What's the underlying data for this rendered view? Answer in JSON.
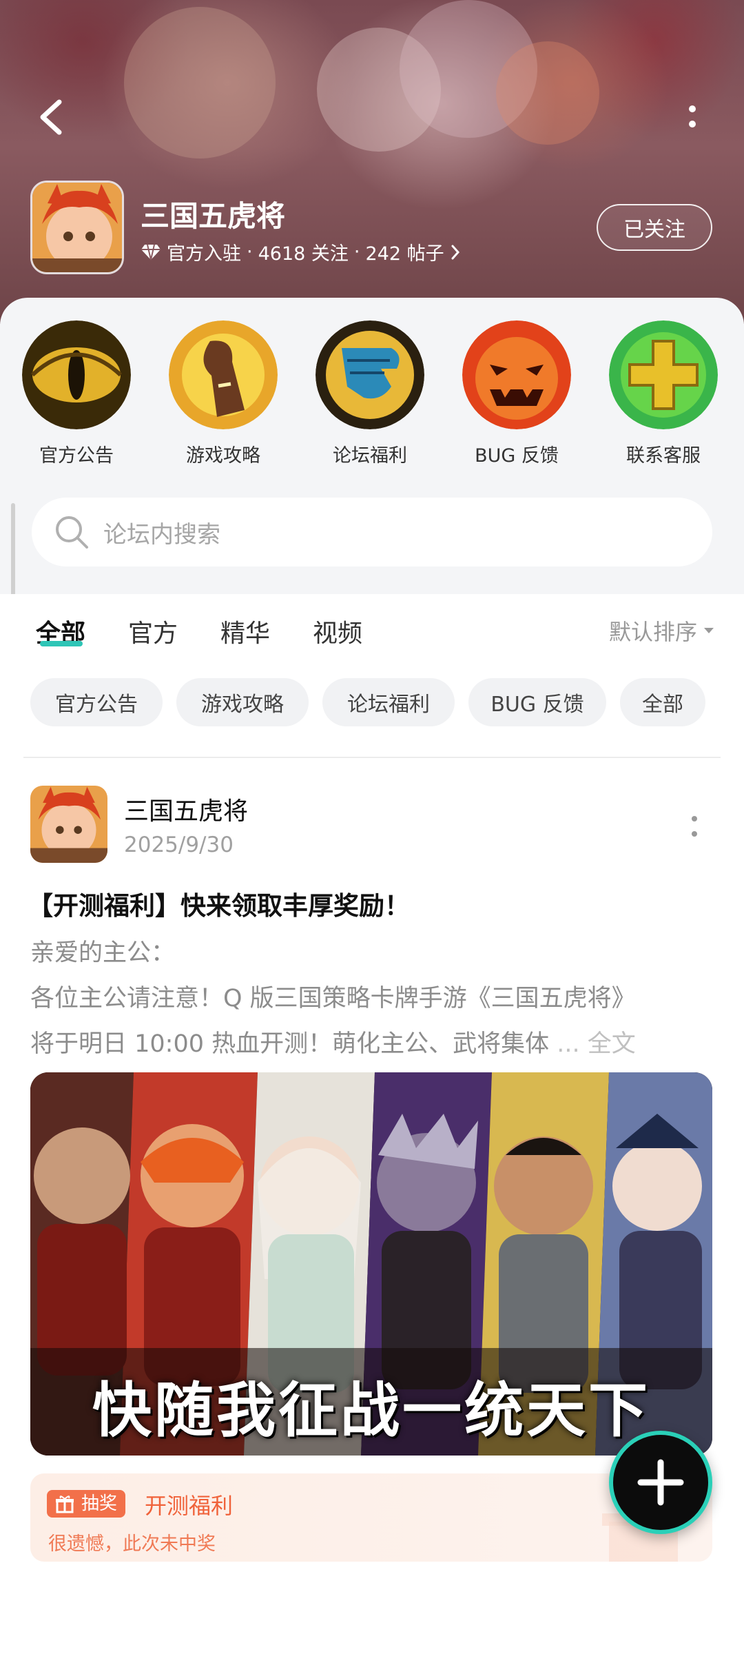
{
  "header": {
    "title": "三国五虎将",
    "official": "官方入驻",
    "follows": "4618 关注",
    "posts": "242 帖子",
    "sep": "·",
    "follow_label": "已关注"
  },
  "shortcuts": [
    {
      "label": "官方公告"
    },
    {
      "label": "游戏攻略"
    },
    {
      "label": "论坛福利"
    },
    {
      "label": "BUG 反馈"
    },
    {
      "label": "联系客服"
    }
  ],
  "search": {
    "placeholder": "论坛内搜索"
  },
  "tabs": [
    {
      "label": "全部"
    },
    {
      "label": "官方"
    },
    {
      "label": "精华"
    },
    {
      "label": "视频"
    }
  ],
  "sort_label": "默认排序",
  "chips": [
    {
      "label": "官方公告"
    },
    {
      "label": "游戏攻略"
    },
    {
      "label": "论坛福利"
    },
    {
      "label": "BUG 反馈"
    },
    {
      "label": "全部"
    }
  ],
  "post": {
    "author": "三国五虎将",
    "date": "2025/9/30",
    "title": "【开测福利】快来领取丰厚奖励！",
    "body": [
      "亲爱的主公：",
      " 各位主公请注意！Q 版三国策略卡牌手游《三国五虎将》",
      "将于明日 10:00 热血开测！萌化主公、武将集体 "
    ],
    "ellipsis": "... 全文",
    "banner_text": "快随我征战一统天下"
  },
  "lottery": {
    "badge": "抽奖",
    "title": "开测福利",
    "result": "很遗憾，此次未中奖"
  },
  "colors": {
    "accent": "#2ec5b6",
    "lottery": "#f2704a"
  }
}
